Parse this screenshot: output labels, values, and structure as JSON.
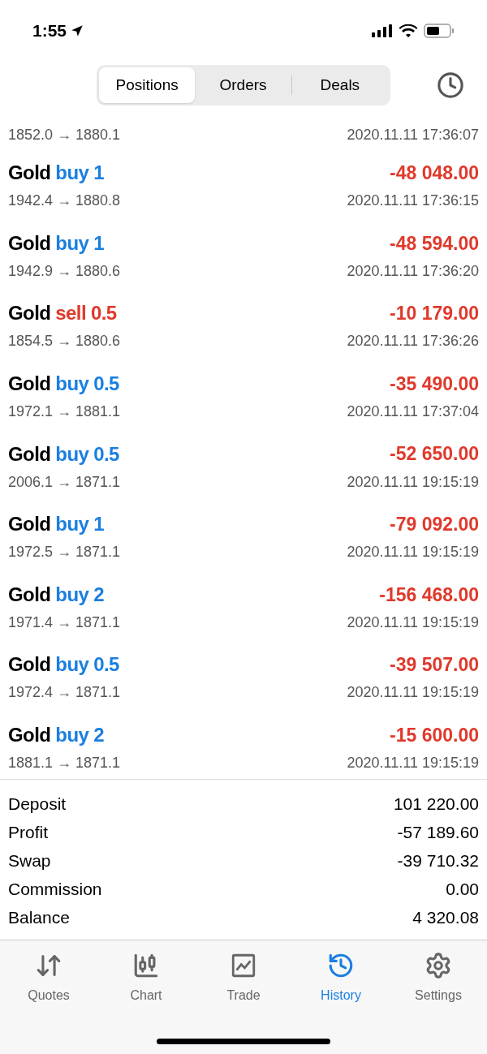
{
  "status_bar": {
    "time": "1:55"
  },
  "tabs": [
    {
      "label": "Positions",
      "selected": true
    },
    {
      "label": "Orders",
      "selected": false
    },
    {
      "label": "Deals",
      "selected": false
    }
  ],
  "partial_row": {
    "prices": "1852.0 → 1880.1",
    "time": "2020.11.11 17:36:07"
  },
  "positions": [
    {
      "symbol": "Gold",
      "kind": "buy",
      "trade": "buy 1",
      "profit": "-48 048.00",
      "prices": "1942.4 → 1880.8",
      "time": "2020.11.11 17:36:15"
    },
    {
      "symbol": "Gold",
      "kind": "buy",
      "trade": "buy 1",
      "profit": "-48 594.00",
      "prices": "1942.9 → 1880.6",
      "time": "2020.11.11 17:36:20"
    },
    {
      "symbol": "Gold",
      "kind": "sell",
      "trade": "sell 0.5",
      "profit": "-10 179.00",
      "prices": "1854.5 → 1880.6",
      "time": "2020.11.11 17:36:26"
    },
    {
      "symbol": "Gold",
      "kind": "buy",
      "trade": "buy 0.5",
      "profit": "-35 490.00",
      "prices": "1972.1 → 1881.1",
      "time": "2020.11.11 17:37:04"
    },
    {
      "symbol": "Gold",
      "kind": "buy",
      "trade": "buy 0.5",
      "profit": "-52 650.00",
      "prices": "2006.1 → 1871.1",
      "time": "2020.11.11 19:15:19"
    },
    {
      "symbol": "Gold",
      "kind": "buy",
      "trade": "buy 1",
      "profit": "-79 092.00",
      "prices": "1972.5 → 1871.1",
      "time": "2020.11.11 19:15:19"
    },
    {
      "symbol": "Gold",
      "kind": "buy",
      "trade": "buy 2",
      "profit": "-156 468.00",
      "prices": "1971.4 → 1871.1",
      "time": "2020.11.11 19:15:19"
    },
    {
      "symbol": "Gold",
      "kind": "buy",
      "trade": "buy 0.5",
      "profit": "-39 507.00",
      "prices": "1972.4 → 1871.1",
      "time": "2020.11.11 19:15:19"
    },
    {
      "symbol": "Gold",
      "kind": "buy",
      "trade": "buy 2",
      "profit": "-15 600.00",
      "prices": "1881.1 → 1871.1",
      "time": "2020.11.11 19:15:19"
    }
  ],
  "summary": [
    {
      "label": "Deposit",
      "value": "101 220.00"
    },
    {
      "label": "Profit",
      "value": "-57 189.60"
    },
    {
      "label": "Swap",
      "value": "-39 710.32"
    },
    {
      "label": "Commission",
      "value": "0.00"
    },
    {
      "label": "Balance",
      "value": "4 320.08"
    }
  ],
  "nav": [
    {
      "label": "Quotes",
      "kind": "quotes",
      "selected": false
    },
    {
      "label": "Chart",
      "kind": "chart",
      "selected": false
    },
    {
      "label": "Trade",
      "kind": "trade",
      "selected": false
    },
    {
      "label": "History",
      "kind": "history",
      "selected": true
    },
    {
      "label": "Settings",
      "kind": "settings",
      "selected": false
    }
  ]
}
